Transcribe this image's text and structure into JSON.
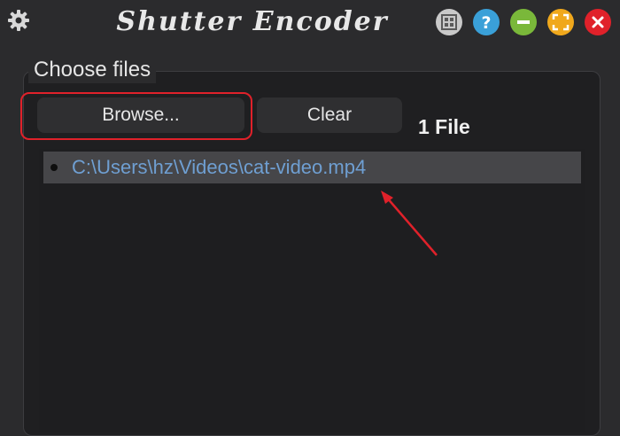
{
  "window": {
    "title": "Shutter Encoder",
    "settings_icon": "gear-icon",
    "buttons": [
      {
        "name": "minimize-to-tray-button",
        "icon": "windows-icon",
        "color": "#c9c9c9"
      },
      {
        "name": "help-button",
        "icon": "question-icon",
        "color": "#3aa0d8"
      },
      {
        "name": "minimize-button",
        "icon": "minus-icon",
        "color": "#7ab83a"
      },
      {
        "name": "maximize-button",
        "icon": "expand-icon",
        "color": "#f0a81c"
      },
      {
        "name": "close-button",
        "icon": "close-icon",
        "color": "#e0212a"
      }
    ]
  },
  "choose_files": {
    "title": "Choose files",
    "browse_label": "Browse...",
    "clear_label": "Clear",
    "count_label": "1 File",
    "files": [
      "C:\\Users\\hz\\Videos\\cat-video.mp4"
    ]
  },
  "annotation": {
    "highlight_color": "#e0212a",
    "arrow_color": "#e0212a"
  }
}
